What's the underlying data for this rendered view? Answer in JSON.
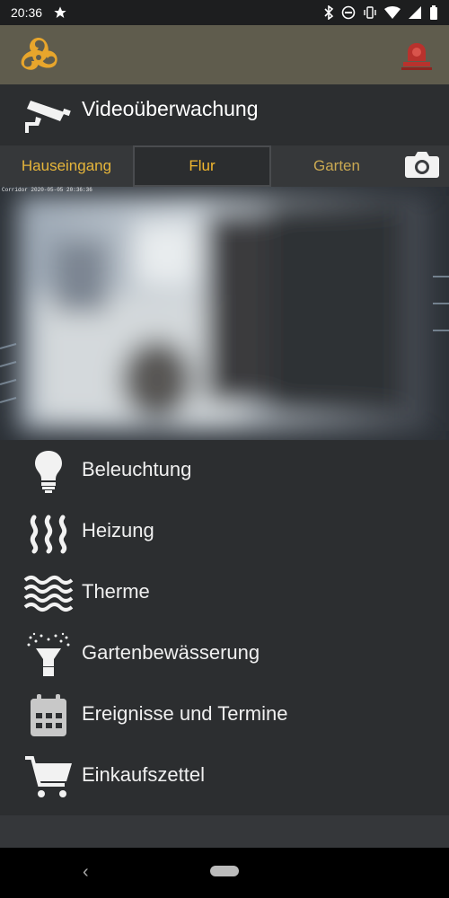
{
  "status_bar": {
    "time": "20:36",
    "left_icons": [
      "star-icon"
    ],
    "right_icons": [
      "bluetooth-icon",
      "dnd-icon",
      "vibrate-icon",
      "wifi-icon",
      "signal-icon",
      "battery-icon"
    ]
  },
  "header": {
    "logo_icon": "triskelion-logo",
    "alarm_icon": "alarm-siren-icon",
    "colors": {
      "background": "#5f5c4d",
      "logo": "#e8a62c",
      "alarm": "#b8322d"
    }
  },
  "video": {
    "title": "Videoüberwachung",
    "icon": "security-camera-icon",
    "tabs": [
      {
        "label": "Hauseingang",
        "selected": false
      },
      {
        "label": "Flur",
        "selected": true
      },
      {
        "label": "Garten",
        "selected": false
      }
    ],
    "snapshot_icon": "photo-camera-icon",
    "camera_timestamp": "Corridor 2020-05-05 20:36:36"
  },
  "menu": {
    "items": [
      {
        "label": "Beleuchtung",
        "icon": "lightbulb-icon"
      },
      {
        "label": "Heizung",
        "icon": "heating-icon"
      },
      {
        "label": "Therme",
        "icon": "water-waves-icon"
      },
      {
        "label": "Gartenbewässerung",
        "icon": "sprinkler-icon"
      },
      {
        "label": "Ereignisse und Termine",
        "icon": "calendar-icon"
      },
      {
        "label": "Einkaufszettel",
        "icon": "shopping-cart-icon"
      }
    ]
  },
  "nav": {
    "back_glyph": "‹"
  },
  "colors": {
    "accent": "#e6b53a",
    "background": "#2c2e30",
    "tab_bar": "#36383a"
  }
}
